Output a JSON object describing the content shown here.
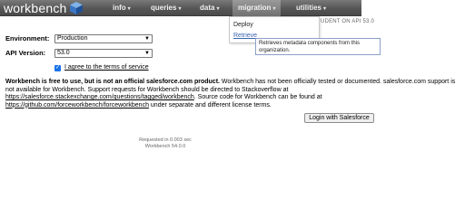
{
  "nav": {
    "logo_text": "workbench",
    "items": [
      {
        "label": "info",
        "caret": "▾"
      },
      {
        "label": "queries",
        "caret": "▾"
      },
      {
        "label": "data",
        "caret": "▾"
      },
      {
        "label": "migration",
        "caret": "▾"
      },
      {
        "label": "utilities",
        "caret": "▾"
      }
    ],
    "active_item": "migration"
  },
  "migration_menu": {
    "items": [
      "Deploy",
      "Retrieve"
    ],
    "hovered": "Retrieve",
    "tooltip": "Retrieves metadata components from this organization."
  },
  "user_info_visible": "UDENT ON API 53.0",
  "form": {
    "environment_label": "Environment:",
    "environment_value": "Production",
    "api_version_label": "API Version:",
    "api_version_value": "53.0",
    "terms_checked": true,
    "terms_label": "I agree to the terms of service"
  },
  "disclaimer": {
    "bold": "Workbench is free to use, but is not an official salesforce.com product.",
    "text1": " Workbench has not been officially tested or documented. salesforce.com support is not available for Workbench. Support requests for Workbench should be directed to Stackoverflow at ",
    "link1": "https://salesforce.stackexchange.com/questions/tagged/workbench",
    "text2": ". Source code for Workbench can be found at ",
    "link2": "https://github.com/forceworkbench/forceworkbench",
    "text3": " under separate and different license terms."
  },
  "login_button": "Login with Salesforce",
  "footer": {
    "requested": "Requested in 0.003 sec",
    "version": "Workbench 54.0.0"
  },
  "colors": {
    "nav_bg": "#565656",
    "link_blue": "#3a63b0",
    "checkbox_blue": "#1a73e8"
  }
}
